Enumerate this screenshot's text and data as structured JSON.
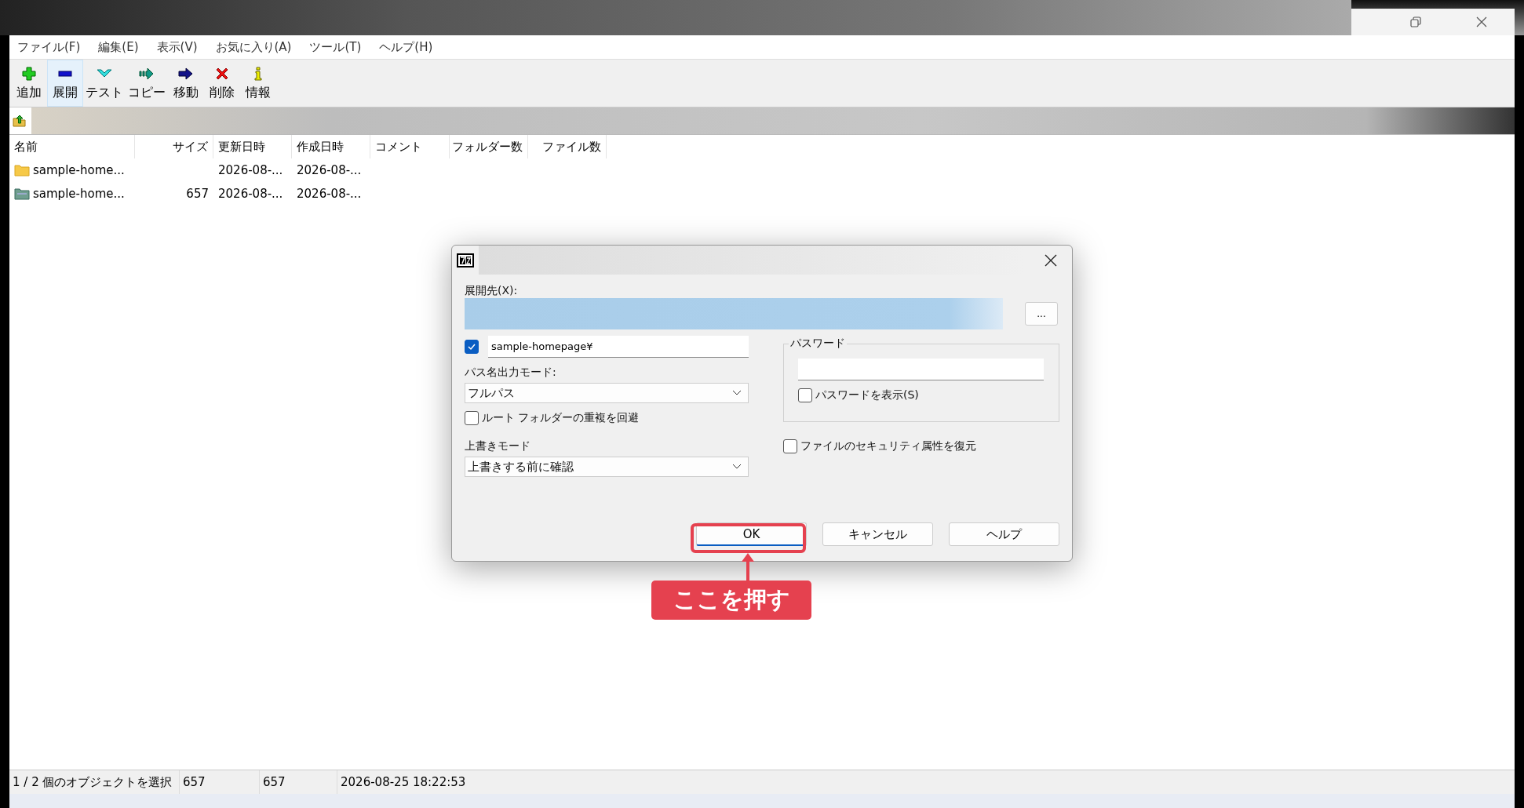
{
  "menu": [
    "ファイル(F)",
    "編集(E)",
    "表示(V)",
    "お気に入り(A)",
    "ツール(T)",
    "ヘルプ(H)"
  ],
  "toolbar": [
    {
      "kind": "add",
      "label": "追加",
      "selected": false
    },
    {
      "kind": "extract",
      "label": "展開",
      "selected": true
    },
    {
      "kind": "test",
      "label": "テスト",
      "selected": false
    },
    {
      "kind": "copy",
      "label": "コピー",
      "selected": false
    },
    {
      "kind": "move",
      "label": "移動",
      "selected": false
    },
    {
      "kind": "delete",
      "label": "削除",
      "selected": false
    },
    {
      "kind": "info",
      "label": "情報",
      "selected": false
    }
  ],
  "columns": [
    "名前",
    "サイズ",
    "更新日時",
    "作成日時",
    "コメント",
    "フォルダー数",
    "ファイル数"
  ],
  "rows": [
    {
      "kind": "folder",
      "name": "sample-home...",
      "modified": "2026-08-...",
      "created": "2026-08-..."
    },
    {
      "kind": "archive",
      "name": "sample-home...",
      "size": "657",
      "modified": "2026-08-...",
      "created": "2026-08-..."
    }
  ],
  "dialog": {
    "destination_label": "展開先(X):",
    "browse_button": "...",
    "subfolder": {
      "checked": true,
      "value": "sample-homepage¥"
    },
    "path_mode": {
      "label": "パス名出力モード:",
      "value": "フルパス"
    },
    "avoid_duplicate": {
      "label": "ルート フォルダーの重複を回避",
      "checked": false
    },
    "overwrite": {
      "label": "上書きモード",
      "value": "上書きする前に確認"
    },
    "password": {
      "title": "パスワード",
      "show": {
        "label": "パスワードを表示(S)",
        "checked": false
      }
    },
    "restore_security": {
      "label": "ファイルのセキュリティ属性を復元",
      "checked": false
    },
    "buttons": [
      {
        "label": "OK",
        "default": true
      },
      {
        "label": "キャンセル",
        "default": false
      },
      {
        "label": "ヘルプ",
        "default": false
      }
    ]
  },
  "annotation": {
    "text": "ここを押す"
  },
  "status_bar": [
    "1 / 2 個のオブジェクトを選択",
    "657",
    "657",
    "2026-08-25 18:22:53"
  ]
}
